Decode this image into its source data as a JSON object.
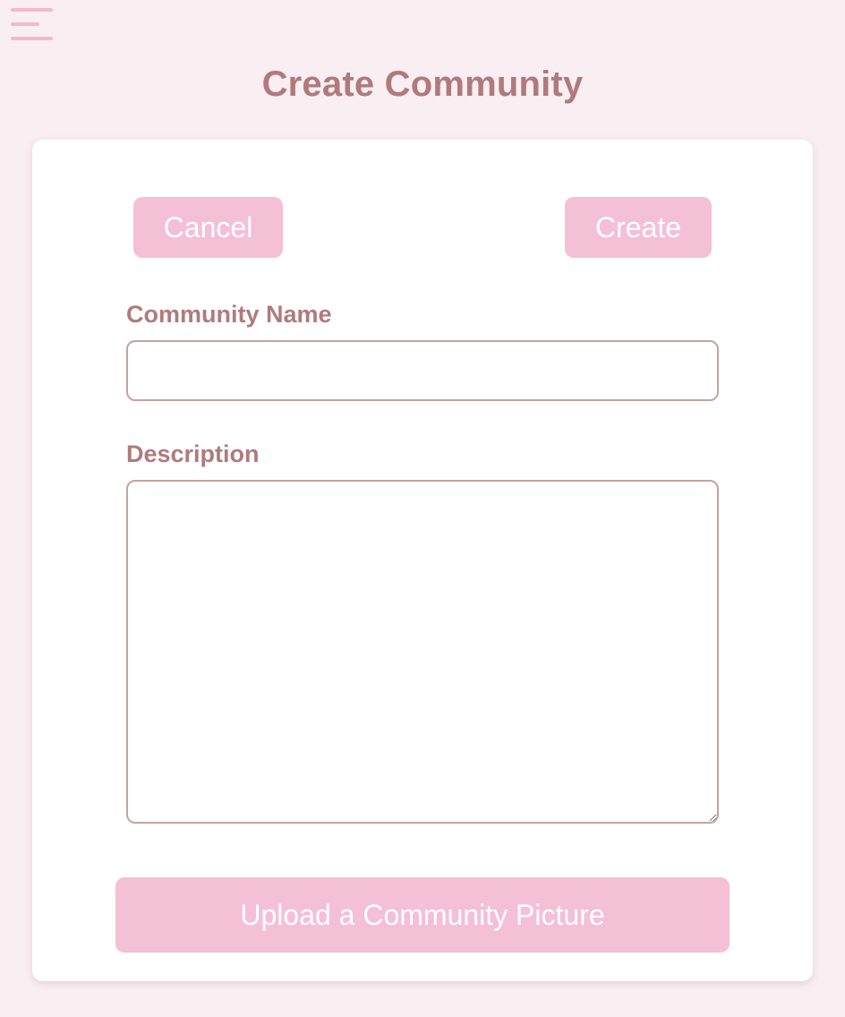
{
  "header": {
    "menu_icon": "hamburger-menu-icon",
    "title": "Create Community"
  },
  "form": {
    "cancel_label": "Cancel",
    "create_label": "Create",
    "name_label": "Community Name",
    "name_value": "",
    "description_label": "Description",
    "description_value": "",
    "upload_label": "Upload a Community Picture"
  },
  "colors": {
    "background": "#f9eef2",
    "card": "#ffffff",
    "accent": "#f4c0d5",
    "heading": "#b07a7c",
    "input_border": "#c4a49e"
  }
}
